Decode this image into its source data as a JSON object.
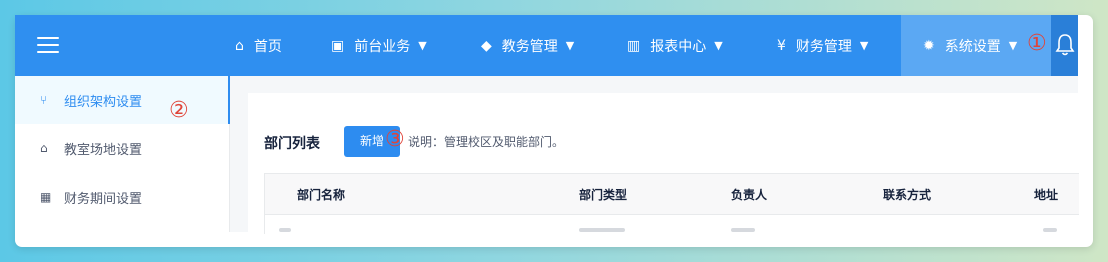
{
  "topbar": {
    "nav": [
      {
        "label": "首页",
        "icon": "home-icon"
      },
      {
        "label": "前台业务",
        "icon": "monitor-icon"
      },
      {
        "label": "教务管理",
        "icon": "graduation-cap-icon"
      },
      {
        "label": "报表中心",
        "icon": "bar-chart-icon"
      },
      {
        "label": "财务管理",
        "icon": "yen-icon"
      },
      {
        "label": "系统设置",
        "icon": "gear-icon",
        "active": true
      }
    ],
    "annotation_1": "①"
  },
  "sidebar": {
    "items": [
      {
        "label": "组织架构设置",
        "icon": "org-tree-icon",
        "active": true
      },
      {
        "label": "教室场地设置",
        "icon": "home-icon"
      },
      {
        "label": "财务期间设置",
        "icon": "calendar-icon"
      }
    ],
    "annotation_2": "②"
  },
  "main": {
    "title": "部门列表",
    "add_button": "新增",
    "annotation_3": "③",
    "note": "说明：管理校区及职能部门。",
    "table": {
      "columns": [
        "部门名称",
        "部门类型",
        "负责人",
        "联系方式",
        "地址"
      ]
    }
  },
  "colors": {
    "brand": "#2f8ff0",
    "annotation": "#e0453a"
  }
}
